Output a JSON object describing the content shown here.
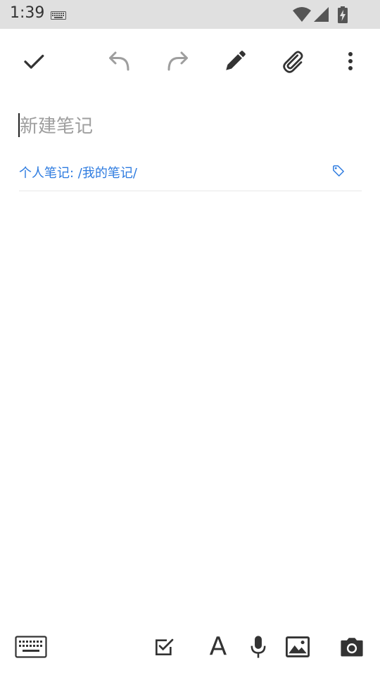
{
  "status_bar": {
    "time": "1:39",
    "icons": [
      "keyboard-icon",
      "wifi-icon",
      "signal-icon",
      "battery-charging-icon"
    ]
  },
  "toolbar": {
    "icons": [
      "check-icon",
      "undo-icon",
      "redo-icon",
      "pen-icon",
      "paperclip-icon",
      "more-vert-icon"
    ]
  },
  "note": {
    "title_placeholder": "新建笔记",
    "notebook_path": "个人笔记: /我的笔记/",
    "tag_icon": "tag-icon"
  },
  "bottom_bar": {
    "icons": [
      "keyboard-icon",
      "checkbox-icon",
      "text-format-icon",
      "mic-icon",
      "image-icon",
      "camera-icon"
    ],
    "text_format_label": "A"
  },
  "colors": {
    "status_bar_bg": "#e0e0e0",
    "accent": "#2d7be0",
    "icon_dark": "#333333",
    "icon_disabled": "#9e9e9e",
    "placeholder": "#9e9e9e"
  }
}
